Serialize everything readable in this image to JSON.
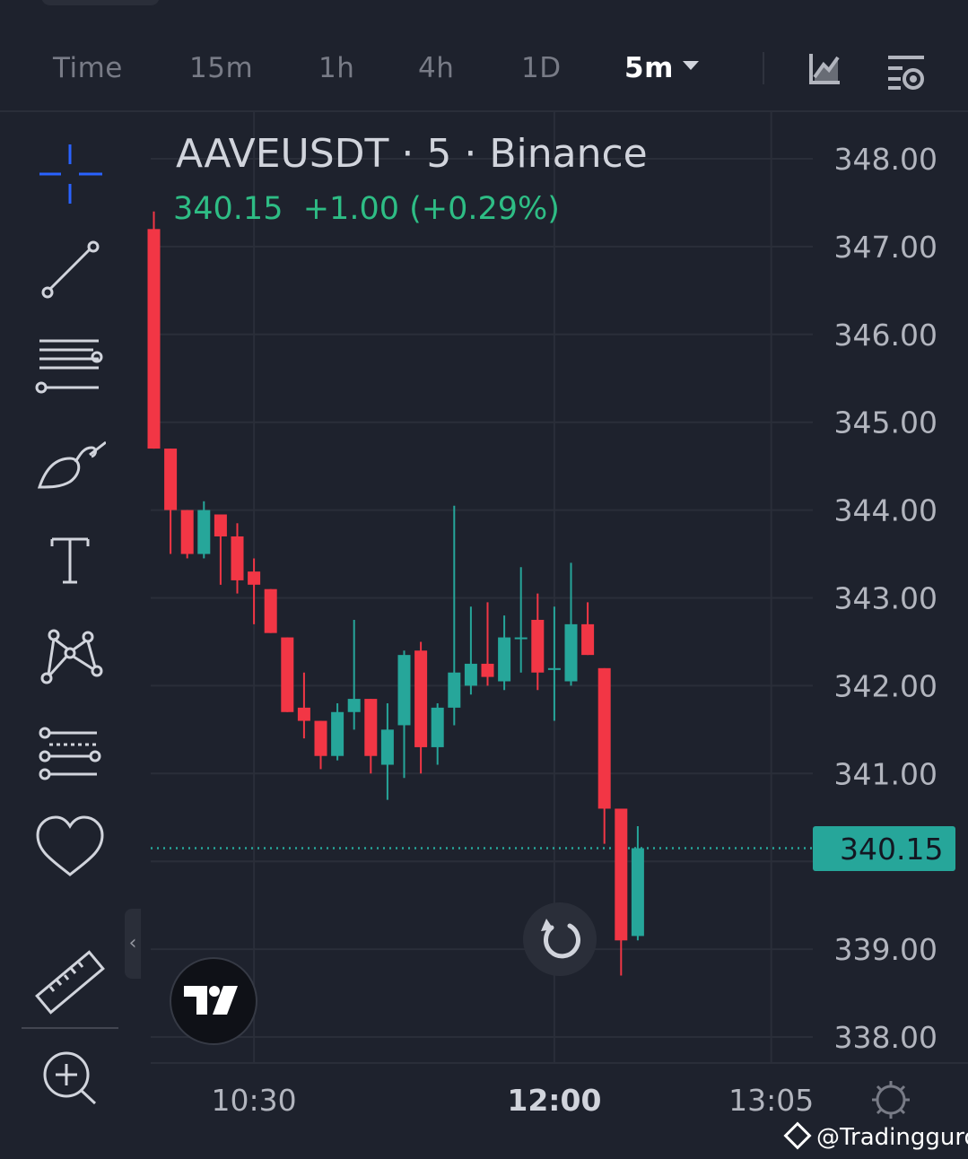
{
  "toolbar": {
    "timeframes": [
      "Time",
      "15m",
      "1h",
      "4h",
      "1D"
    ],
    "active_timeframe": "5m",
    "icons": [
      "chart-type-icon",
      "indicators-settings-icon"
    ]
  },
  "left_tools": [
    "crosshair-icon",
    "trend-line-icon",
    "fib-lines-icon",
    "brush-icon",
    "text-icon",
    "pattern-icon",
    "prediction-icon",
    "favorites-heart-icon",
    "ruler-icon",
    "zoom-in-icon"
  ],
  "header": {
    "symbol": "AAVEUSDT · 5 · Binance",
    "last_price": "340.15",
    "change": "+1.00 (+0.29%)"
  },
  "price_tag": "340.15",
  "watermark": "@Tradingguro",
  "colors": {
    "up": "#26a69a",
    "down": "#f23645",
    "background": "#1e222d",
    "grid": "#2a2e39",
    "axis_text": "#b2b5be"
  },
  "chart_data": {
    "type": "candlestick",
    "symbol": "AAVEUSDT",
    "interval": "5",
    "exchange": "Binance",
    "y_ticks": [
      "348.00",
      "347.00",
      "346.00",
      "345.00",
      "344.00",
      "343.00",
      "342.00",
      "341.00",
      "339.00",
      "338.00"
    ],
    "ylim": [
      337.7,
      348.3
    ],
    "x_ticks": [
      {
        "label": "10:30",
        "bold": false,
        "index": 6
      },
      {
        "label": "12:00",
        "bold": true,
        "index": 24
      },
      {
        "label": "13:05",
        "bold": false,
        "index": 37
      }
    ],
    "last_price": 340.15,
    "candles": [
      {
        "o": 347.2,
        "h": 347.4,
        "l": 344.7,
        "c": 344.7
      },
      {
        "o": 344.7,
        "h": 344.7,
        "l": 343.5,
        "c": 344.0
      },
      {
        "o": 344.0,
        "h": 344.0,
        "l": 343.45,
        "c": 343.5
      },
      {
        "o": 343.5,
        "h": 344.1,
        "l": 343.45,
        "c": 344.0
      },
      {
        "o": 343.95,
        "h": 343.95,
        "l": 343.15,
        "c": 343.7
      },
      {
        "o": 343.7,
        "h": 343.85,
        "l": 343.05,
        "c": 343.2
      },
      {
        "o": 343.3,
        "h": 343.45,
        "l": 342.7,
        "c": 343.15
      },
      {
        "o": 343.1,
        "h": 343.1,
        "l": 342.6,
        "c": 342.6
      },
      {
        "o": 342.55,
        "h": 342.55,
        "l": 341.7,
        "c": 341.7
      },
      {
        "o": 341.75,
        "h": 342.15,
        "l": 341.4,
        "c": 341.6
      },
      {
        "o": 341.6,
        "h": 341.6,
        "l": 341.05,
        "c": 341.2
      },
      {
        "o": 341.2,
        "h": 341.8,
        "l": 341.15,
        "c": 341.7
      },
      {
        "o": 341.7,
        "h": 342.75,
        "l": 341.5,
        "c": 341.85
      },
      {
        "o": 341.85,
        "h": 341.85,
        "l": 341.0,
        "c": 341.2
      },
      {
        "o": 341.1,
        "h": 341.8,
        "l": 340.7,
        "c": 341.5
      },
      {
        "o": 341.55,
        "h": 342.4,
        "l": 340.95,
        "c": 342.35
      },
      {
        "o": 342.4,
        "h": 342.5,
        "l": 341.0,
        "c": 341.3
      },
      {
        "o": 341.3,
        "h": 341.8,
        "l": 341.1,
        "c": 341.75
      },
      {
        "o": 341.75,
        "h": 344.05,
        "l": 341.55,
        "c": 342.15
      },
      {
        "o": 342.0,
        "h": 342.9,
        "l": 341.9,
        "c": 342.25
      },
      {
        "o": 342.25,
        "h": 342.95,
        "l": 342.0,
        "c": 342.1
      },
      {
        "o": 342.05,
        "h": 342.8,
        "l": 341.95,
        "c": 342.55
      },
      {
        "o": 342.55,
        "h": 343.35,
        "l": 342.15,
        "c": 342.55
      },
      {
        "o": 342.75,
        "h": 343.05,
        "l": 341.95,
        "c": 342.15
      },
      {
        "o": 342.2,
        "h": 342.9,
        "l": 341.6,
        "c": 342.2
      },
      {
        "o": 342.05,
        "h": 343.4,
        "l": 342.0,
        "c": 342.7
      },
      {
        "o": 342.7,
        "h": 342.95,
        "l": 342.35,
        "c": 342.35
      },
      {
        "o": 342.2,
        "h": 342.2,
        "l": 340.2,
        "c": 340.6
      },
      {
        "o": 340.6,
        "h": 340.6,
        "l": 338.7,
        "c": 339.1
      },
      {
        "o": 339.15,
        "h": 340.4,
        "l": 339.1,
        "c": 340.15
      }
    ]
  }
}
